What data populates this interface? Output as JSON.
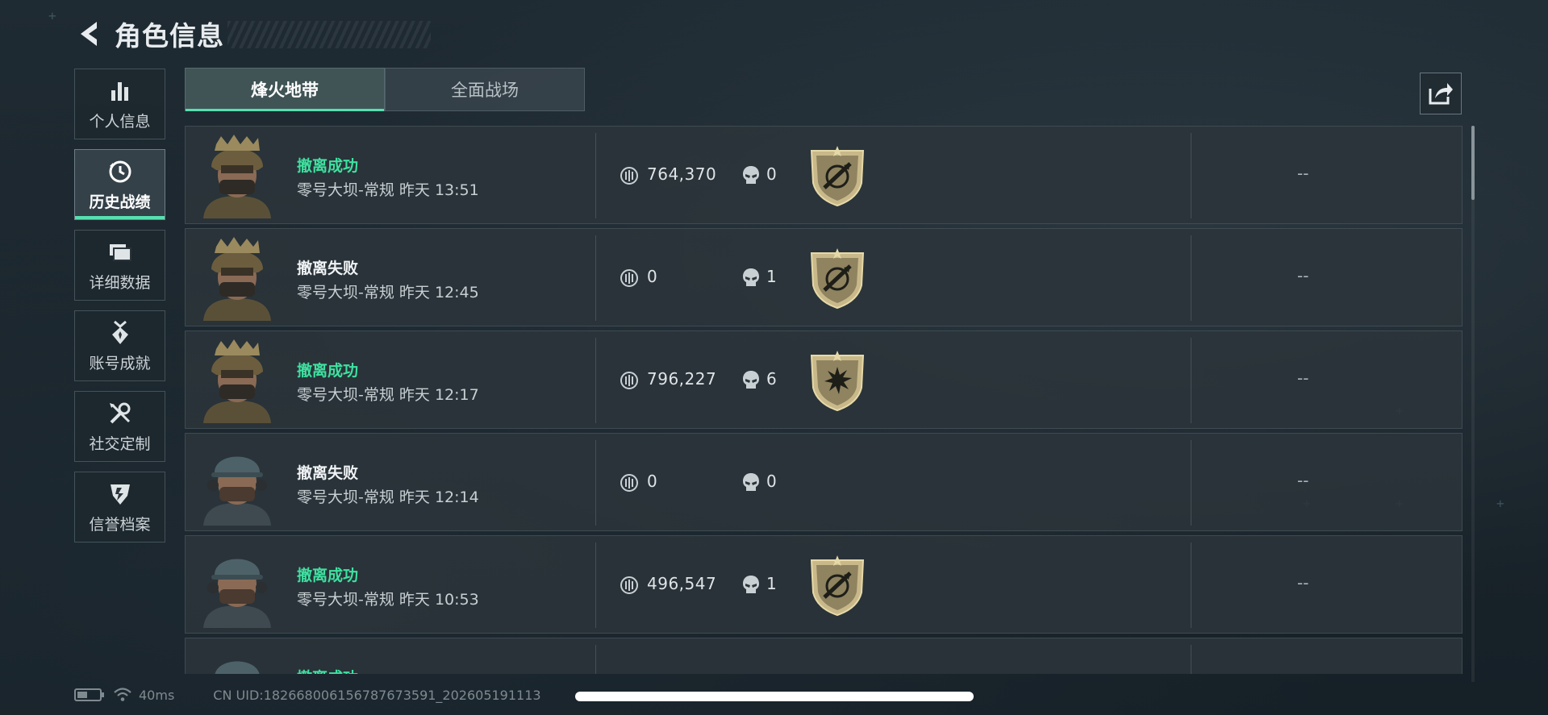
{
  "header": {
    "title": "角色信息"
  },
  "sidebar": {
    "items": [
      {
        "label": "个人信息",
        "icon": "bar-chart-icon"
      },
      {
        "label": "历史战绩",
        "icon": "clock-icon"
      },
      {
        "label": "详细数据",
        "icon": "cards-icon"
      },
      {
        "label": "账号成就",
        "icon": "medal-icon"
      },
      {
        "label": "社交定制",
        "icon": "tools-icon"
      },
      {
        "label": "信誉档案",
        "icon": "shield-icon"
      }
    ],
    "active_index": 1
  },
  "tabs": [
    {
      "label": "烽火地带",
      "active": true
    },
    {
      "label": "全面战场",
      "active": false
    }
  ],
  "matches": [
    {
      "status": "撤离成功",
      "success": true,
      "map": "零号大坝-常规",
      "time": "昨天 13:51",
      "value": "764,370",
      "kills": "0",
      "badge": "rifle",
      "extra": "--",
      "avatar": "soldier-helmet"
    },
    {
      "status": "撤离失败",
      "success": false,
      "map": "零号大坝-常规",
      "time": "昨天 12:45",
      "value": "0",
      "kills": "1",
      "badge": "rifle",
      "extra": "--",
      "avatar": "soldier-helmet"
    },
    {
      "status": "撤离成功",
      "success": true,
      "map": "零号大坝-常规",
      "time": "昨天 12:17",
      "value": "796,227",
      "kills": "6",
      "badge": "burst",
      "extra": "--",
      "avatar": "soldier-helmet"
    },
    {
      "status": "撤离失败",
      "success": false,
      "map": "零号大坝-常规",
      "time": "昨天 12:14",
      "value": "0",
      "kills": "0",
      "badge": "",
      "extra": "--",
      "avatar": "soldier-cap"
    },
    {
      "status": "撤离成功",
      "success": true,
      "map": "零号大坝-常规",
      "time": "昨天 10:53",
      "value": "496,547",
      "kills": "1",
      "badge": "rifle",
      "extra": "--",
      "avatar": "soldier-cap"
    },
    {
      "status": "撤离成功",
      "success": true,
      "map": "",
      "time": "",
      "value": "",
      "kills": "",
      "badge": "",
      "extra": "",
      "avatar": "soldier-cap"
    }
  ],
  "footer": {
    "ping": "40ms",
    "uid": "CN UID:182668006156787673591_202605191113"
  },
  "colors": {
    "success": "#3fe0a0",
    "accent": "#57e0b0",
    "badge_gold": "#c9b98a"
  }
}
